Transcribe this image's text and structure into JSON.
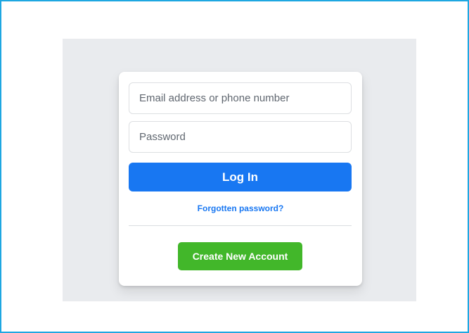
{
  "login_form": {
    "email_placeholder": "Email address or phone number",
    "email_value": "",
    "password_placeholder": "Password",
    "password_value": "",
    "login_label": "Log In",
    "forgot_password_label": "Forgotten password?",
    "create_account_label": "Create New Account"
  },
  "colors": {
    "frame_border": "#1ea7e1",
    "panel_background": "#e9ebee",
    "primary_blue": "#1877f2",
    "create_green": "#42b72a"
  }
}
